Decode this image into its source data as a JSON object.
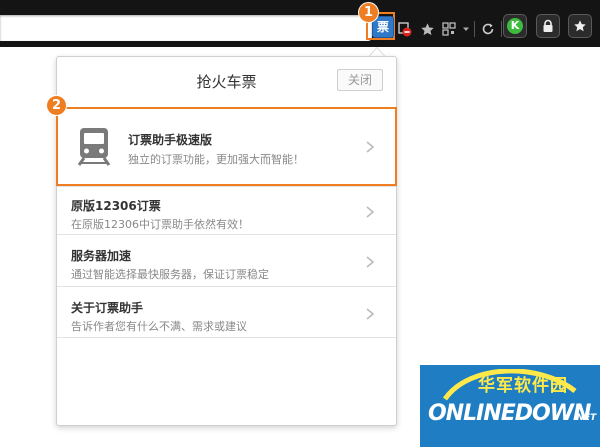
{
  "colors": {
    "highlight": "#ef7d22",
    "ticket_icon": "#2f79c8",
    "toolbar_bg": "#141414",
    "watermark_bg": "#1f7ec3"
  },
  "toolbar": {
    "ticket_extension_label": "票",
    "icons": [
      "ticket-icon",
      "adblock-icon",
      "star-icon",
      "qrcode-icon",
      "dropdown-icon",
      "refresh-icon",
      "k-extension-icon",
      "lock-icon",
      "bookmark-star-icon"
    ],
    "k_extension_label": "K"
  },
  "markers": {
    "step1": "1",
    "step2": "2"
  },
  "popup": {
    "title": "抢火车票",
    "close_label": "关闭",
    "items": [
      {
        "title": "订票助手极速版",
        "desc": "独立的订票功能，更加强大而智能！",
        "icon": "train-icon"
      },
      {
        "title": "原版12306订票",
        "desc": "在原版12306中订票助手依然有效！"
      },
      {
        "title": "服务器加速",
        "desc": "通过智能选择最快服务器，保证订票稳定"
      },
      {
        "title": "关于订票助手",
        "desc": "告诉作者您有什么不满、需求或建议"
      }
    ]
  },
  "watermark": {
    "cn": "华军软件园",
    "en": "ONLINEDOWN",
    "suffix": ".NET"
  }
}
